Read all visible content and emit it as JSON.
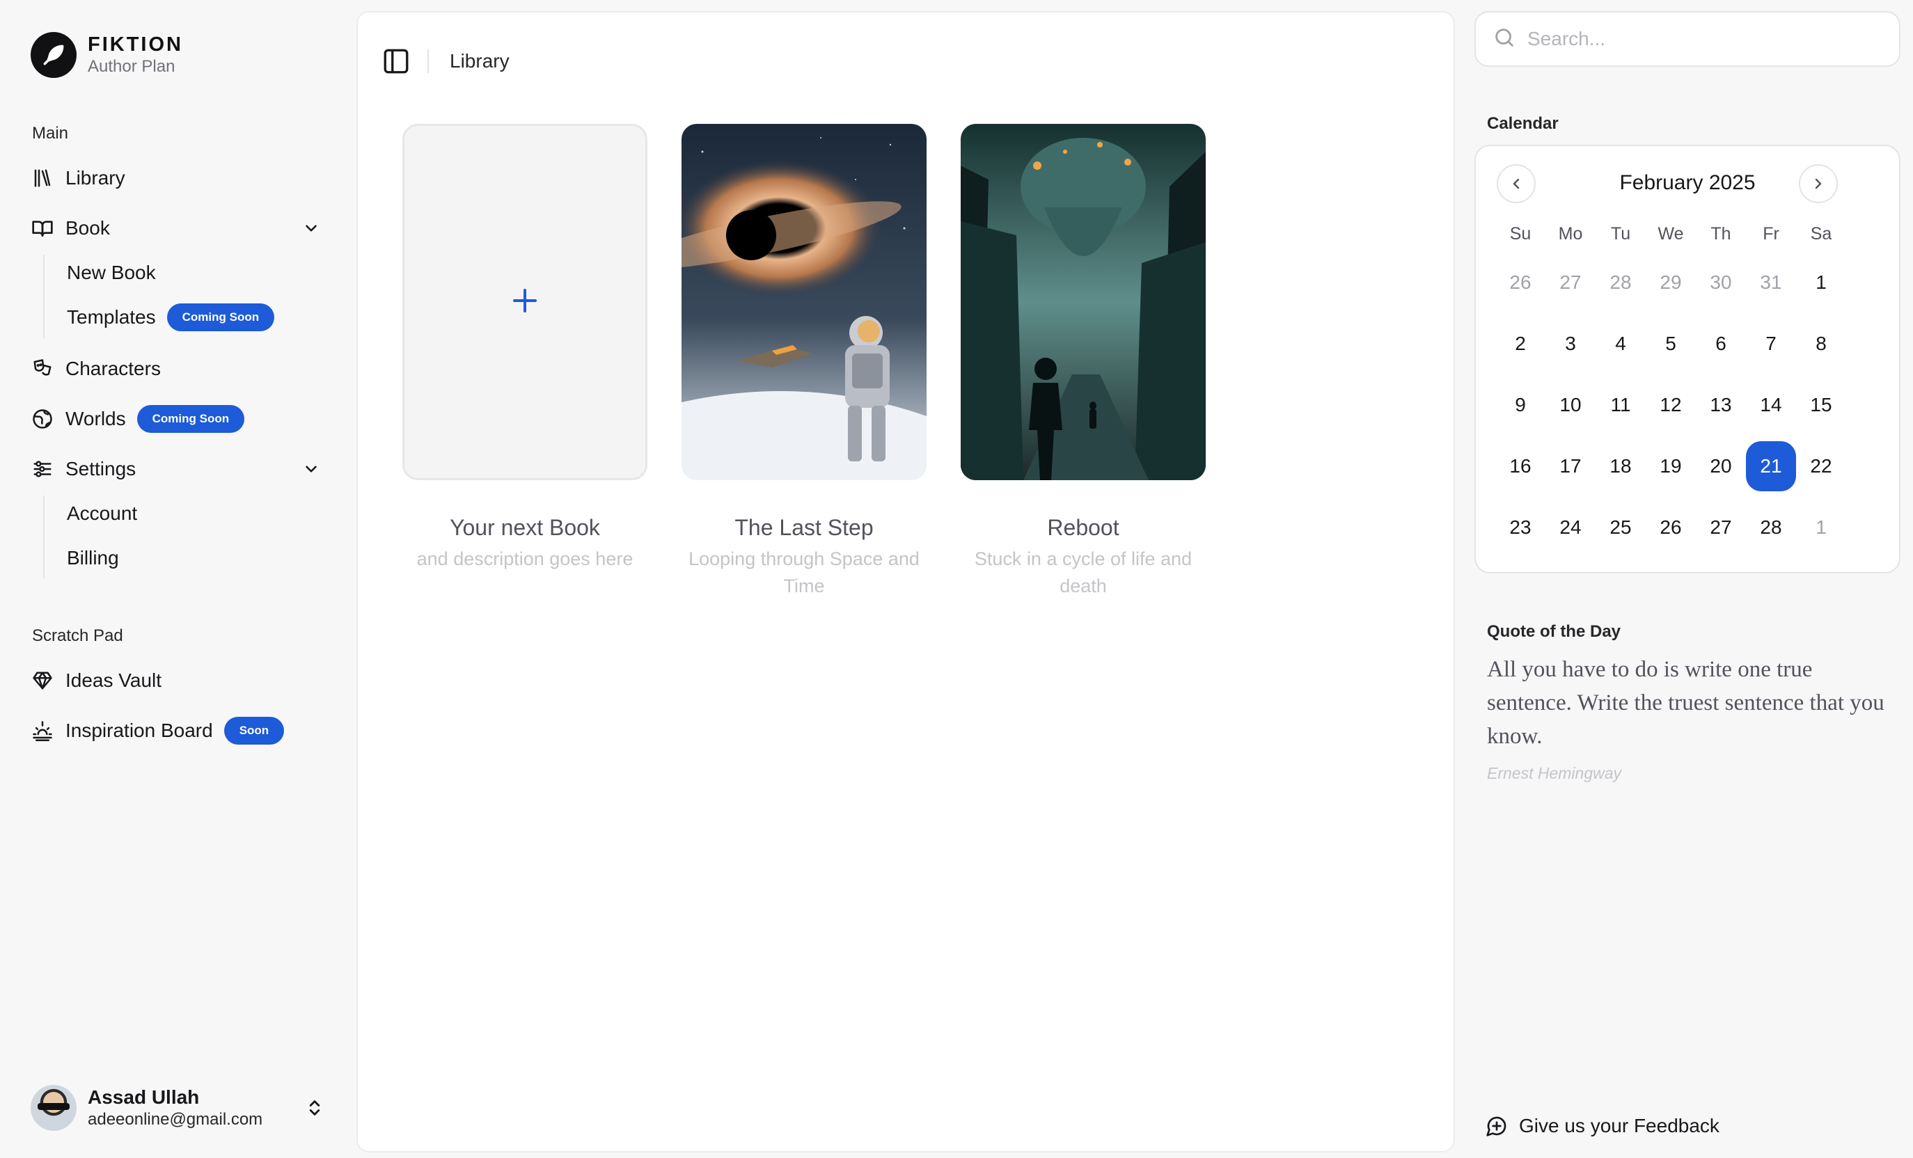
{
  "brand": {
    "name": "FIKTION",
    "plan": "Author Plan"
  },
  "sidebar": {
    "main_label": "Main",
    "library": "Library",
    "book": {
      "label": "Book",
      "items": [
        {
          "label": "New Book"
        },
        {
          "label": "Templates",
          "badge": "Coming Soon"
        }
      ]
    },
    "characters": "Characters",
    "worlds": {
      "label": "Worlds",
      "badge": "Coming Soon"
    },
    "settings": {
      "label": "Settings",
      "items": [
        {
          "label": "Account"
        },
        {
          "label": "Billing"
        }
      ]
    },
    "scratch_label": "Scratch Pad",
    "ideas_vault": "Ideas Vault",
    "inspiration": {
      "label": "Inspiration Board",
      "badge": "Soon"
    }
  },
  "user": {
    "name": "Assad Ullah",
    "email": "adeeonline@gmail.com"
  },
  "header": {
    "breadcrumb": "Library"
  },
  "books": [
    {
      "title": "Your next Book",
      "desc": "and description goes here"
    },
    {
      "title": "The Last Step",
      "desc": "Looping through Space and Time"
    },
    {
      "title": "Reboot",
      "desc": "Stuck in a cycle of life and death"
    }
  ],
  "search": {
    "placeholder": "Search..."
  },
  "calendar": {
    "label": "Calendar",
    "month": "February 2025",
    "weekdays": [
      "Su",
      "Mo",
      "Tu",
      "We",
      "Th",
      "Fr",
      "Sa"
    ],
    "weeks": [
      [
        "26",
        "27",
        "28",
        "29",
        "30",
        "31",
        "1"
      ],
      [
        "2",
        "3",
        "4",
        "5",
        "6",
        "7",
        "8"
      ],
      [
        "9",
        "10",
        "11",
        "12",
        "13",
        "14",
        "15"
      ],
      [
        "16",
        "17",
        "18",
        "19",
        "20",
        "21",
        "22"
      ],
      [
        "23",
        "24",
        "25",
        "26",
        "27",
        "28",
        "1"
      ]
    ],
    "selected": "21"
  },
  "quote": {
    "label": "Quote of the Day",
    "text": "All you have to do is write one true sentence. Write the truest sentence that you know.",
    "author": "Ernest Hemingway"
  },
  "feedback": {
    "label": "Give us your Feedback"
  },
  "colors": {
    "accent": "#1d5bd8",
    "muted_text": "#c4c4c9"
  }
}
